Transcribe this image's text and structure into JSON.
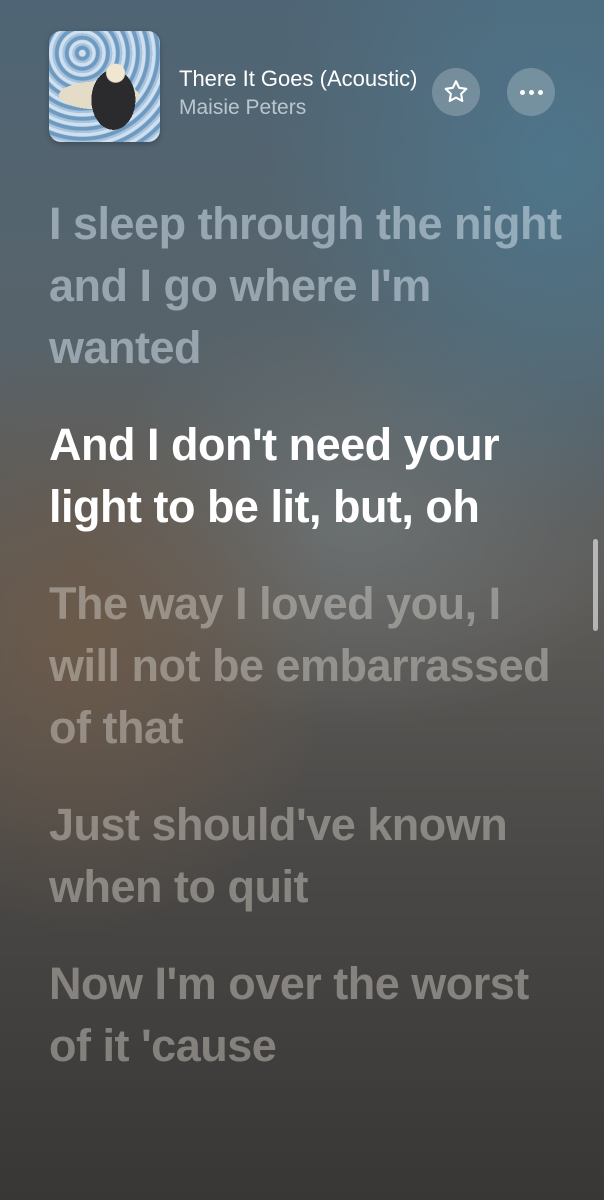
{
  "now_playing": {
    "title": "There It Goes (Acoustic)",
    "artist": "Maisie Peters"
  },
  "actions": {
    "favorite_icon": "star-icon",
    "more_icon": "ellipsis-icon"
  },
  "lyrics": [
    {
      "text": "I sleep through the night and I go where I'm wanted",
      "state": "past"
    },
    {
      "text": "And I don't need your light to be lit, but, oh",
      "state": "current"
    },
    {
      "text": "The way I loved you, I will not be embarrassed of that",
      "state": "future"
    },
    {
      "text": "Just should've known when to quit",
      "state": "future"
    },
    {
      "text": "Now I'm over the worst of it 'cause",
      "state": "future"
    }
  ]
}
